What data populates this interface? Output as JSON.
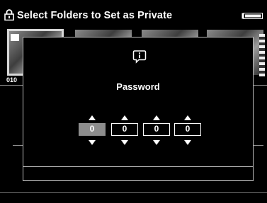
{
  "header": {
    "title": "Select Folders to Set as Private",
    "lock_icon": "lock-icon",
    "battery_icon": "battery-icon"
  },
  "thumbnails": {
    "caption": "010"
  },
  "dialog": {
    "icon": "info-icon",
    "heading": "Password",
    "digits": [
      "0",
      "0",
      "0",
      "0"
    ],
    "selected_digit_index": 0
  },
  "colors": {
    "background": "#000000",
    "text": "#ffffff",
    "selected_digit": "#8d8d8d"
  }
}
